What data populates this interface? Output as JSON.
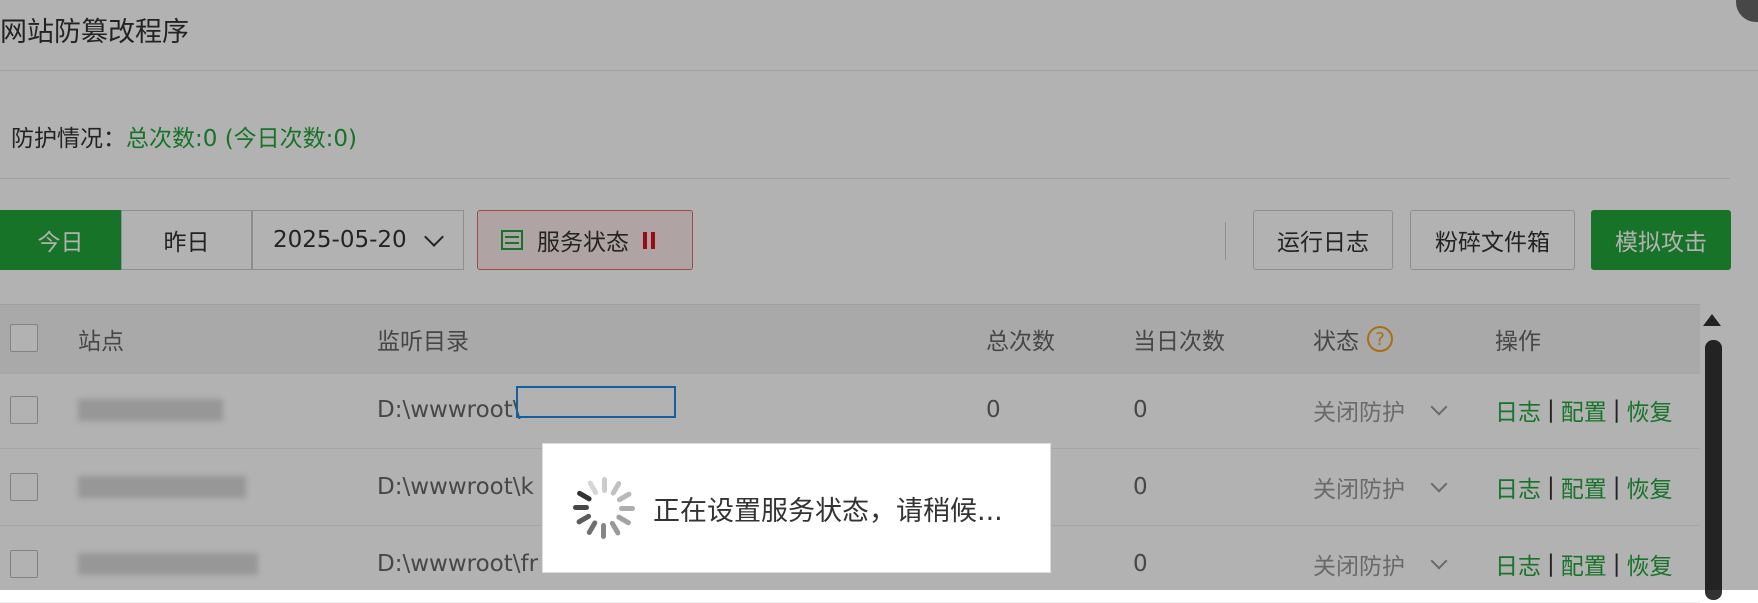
{
  "dialog": {
    "title": "网站防篡改程序"
  },
  "summary": {
    "label": "防护情况：",
    "value": "总次数:0 (今日次数:0)"
  },
  "toolbar": {
    "today": "今日",
    "yesterday": "昨日",
    "date": "2025-05-20",
    "service_status": "服务状态",
    "run_log": "运行日志",
    "shred_box": "粉碎文件箱",
    "simulate_attack": "模拟攻击"
  },
  "table": {
    "headers": {
      "site": "站点",
      "dir": "监听目录",
      "total": "总次数",
      "today": "当日次数",
      "status": "状态",
      "status_help": "?",
      "ops": "操作"
    },
    "rows": [
      {
        "dir": "D:\\wwwroot\\",
        "total": "0",
        "today": "0",
        "status": "关闭防护"
      },
      {
        "dir": "D:\\wwwroot\\k",
        "total": "",
        "today": "0",
        "status": "关闭防护"
      },
      {
        "dir": "D:\\wwwroot\\fr",
        "total": "",
        "today": "0",
        "status": "关闭防护"
      }
    ],
    "ops": {
      "log": "日志",
      "config": "配置",
      "restore": "恢复",
      "sep": "|"
    }
  },
  "loading": {
    "message": "正在设置服务状态，请稍候..."
  },
  "colors": {
    "accent": "#20a53a",
    "danger": "#d9161f",
    "selection": "#1e88e5"
  }
}
